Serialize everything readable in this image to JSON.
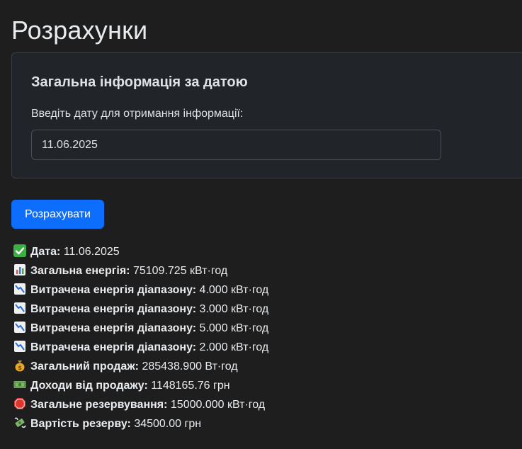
{
  "page": {
    "title": "Розрахунки"
  },
  "card": {
    "title": "Загальна інформація за датою",
    "label": "Введіть дату для отримання інформації:",
    "date_value": "11.06.2025"
  },
  "action": {
    "button_label": "Розрахувати"
  },
  "results": [
    {
      "icon": "check-icon",
      "label": "Дата:",
      "value": "11.06.2025"
    },
    {
      "icon": "bar-chart-icon",
      "label": "Загальна енергія:",
      "value": "75109.725 кВт·год"
    },
    {
      "icon": "chart-decreasing-icon",
      "label": "Витрачена енергія діапазону:",
      "value": "4.000 кВт·год"
    },
    {
      "icon": "chart-decreasing-icon",
      "label": "Витрачена енергія діапазону:",
      "value": "3.000 кВт·год"
    },
    {
      "icon": "chart-decreasing-icon",
      "label": "Витрачена енергія діапазону:",
      "value": "5.000 кВт·год"
    },
    {
      "icon": "chart-decreasing-icon",
      "label": "Витрачена енергія діапазону:",
      "value": "2.000 кВт·год"
    },
    {
      "icon": "money-bag-icon",
      "label": "Загальний продаж:",
      "value": "285438.900 Вт·год"
    },
    {
      "icon": "banknote-icon",
      "label": "Доходи від продажу:",
      "value": "1148165.76 грн"
    },
    {
      "icon": "stop-sign-icon",
      "label": "Загальне резервування:",
      "value": "15000.000 кВт·год"
    },
    {
      "icon": "money-wings-icon",
      "label": "Вартість резерву:",
      "value": "34500.00 грн"
    }
  ],
  "colors": {
    "background": "#1e1e1f",
    "card": "#212429",
    "accent": "#0d6efd"
  }
}
